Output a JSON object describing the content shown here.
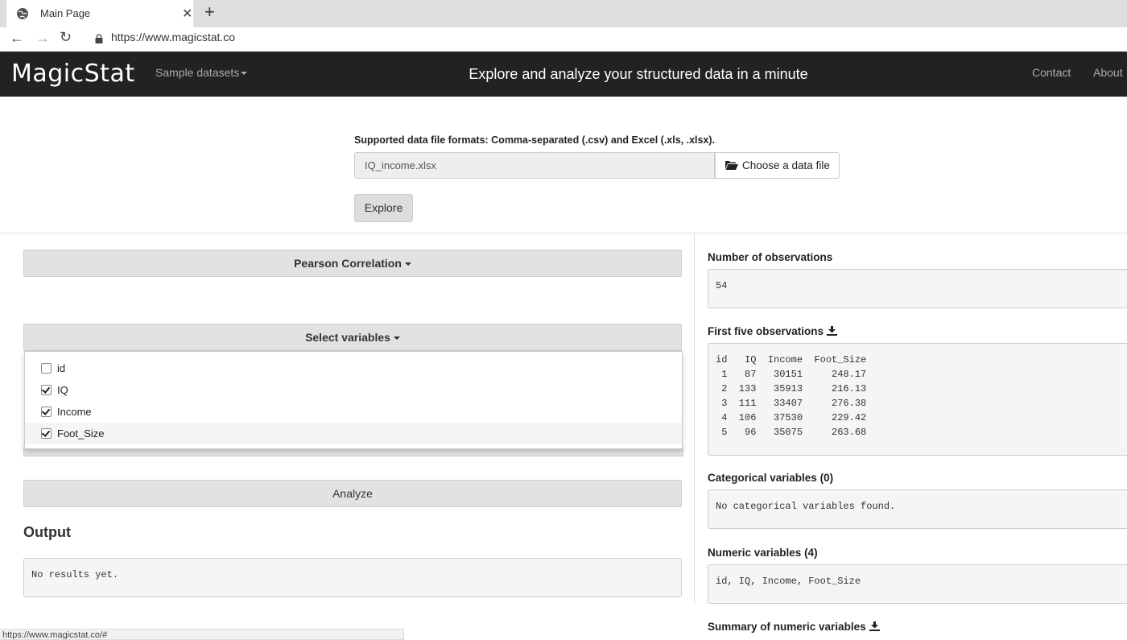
{
  "browser": {
    "tab_title": "Main Page",
    "tab_close": "✕",
    "new_tab": "+",
    "url": "https://www.magicstat.co",
    "status_url": "https://www.magicstat.co/#"
  },
  "navbar": {
    "brand": "MagicStat",
    "sample_datasets": "Sample datasets",
    "tagline": "Explore and analyze your structured data in a minute",
    "contact": "Contact",
    "about": "About"
  },
  "upload": {
    "label": "Supported data file formats: Comma-separated (.csv) and Excel (.xls, .xlsx).",
    "file_value": "IQ_income.xlsx",
    "choose_label": "Choose a data file",
    "explore_label": "Explore"
  },
  "left": {
    "analysis_dropdown": "Pearson Correlation",
    "select_variables": "Select variables",
    "variables": [
      {
        "label": "id",
        "checked": false
      },
      {
        "label": "IQ",
        "checked": true
      },
      {
        "label": "Income",
        "checked": true
      },
      {
        "label": "Foot_Size",
        "checked": true
      }
    ],
    "analyze_label": "Analyze",
    "output_title": "Output",
    "output_text": "No results yet."
  },
  "right": {
    "obs_title": "Number of observations",
    "obs_value": "54",
    "first_five_title": "First five observations",
    "first_five_table": "id   IQ  Income  Foot_Size\n 1   87   30151     248.17\n 2  133   35913     216.13\n 3  111   33407     276.38\n 4  106   37530     229.42\n 5   96   35075     263.68",
    "categorical_title": "Categorical variables (0)",
    "categorical_text": "No categorical variables found.",
    "numeric_title": "Numeric variables (4)",
    "numeric_text": "id, IQ, Income, Foot_Size",
    "summary_title": "Summary of numeric variables"
  }
}
